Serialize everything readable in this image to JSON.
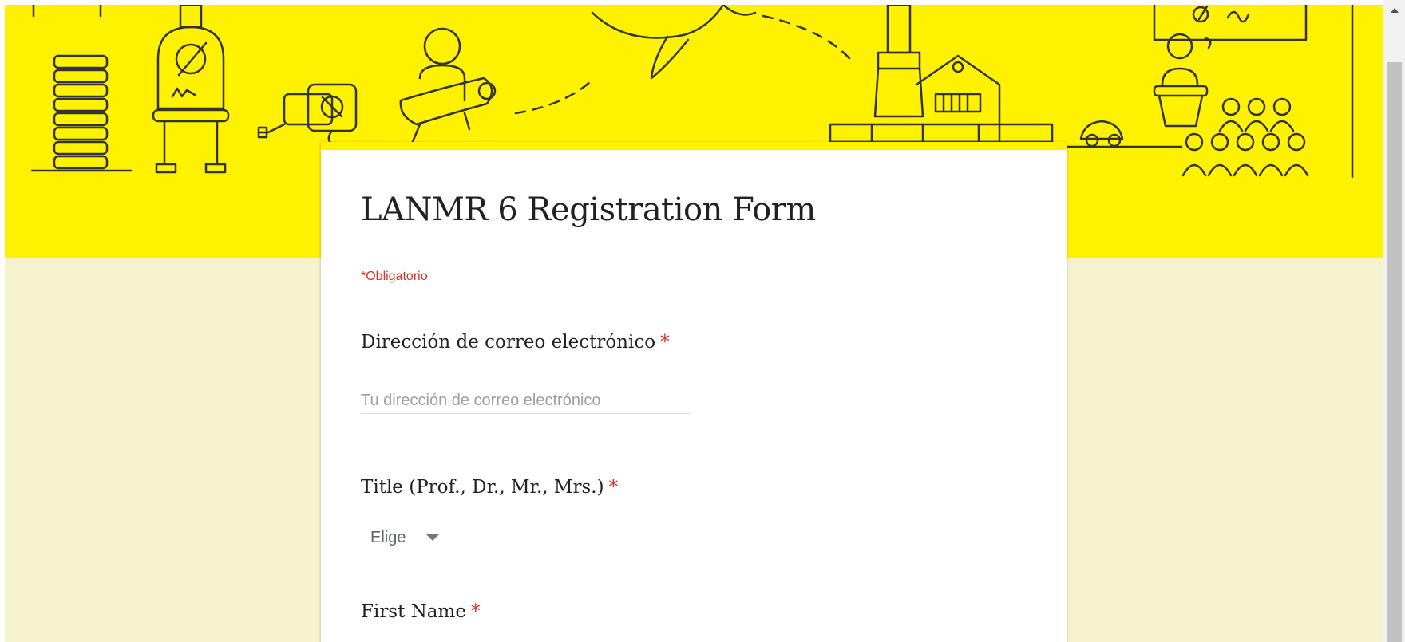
{
  "form": {
    "title": "LANMR 6 Registration Form",
    "required_note": "*Obligatorio"
  },
  "questions": [
    {
      "label": "Dirección de correo electrónico",
      "required_mark": "*"
    },
    {
      "label": "Title (Prof., Dr., Mr., Mrs.)",
      "required_mark": "*"
    },
    {
      "label": "First Name",
      "required_mark": "*"
    }
  ],
  "email_field": {
    "value": "",
    "placeholder": "Tu dirección de correo electrónico"
  },
  "title_select": {
    "selected": "Elige"
  },
  "icons": {
    "dropdown": "chevron-down-icon",
    "scroll_up": "arrow-up-icon"
  },
  "colors": {
    "banner": "#fff200",
    "page_background": "#f5f3cd",
    "card": "#ffffff",
    "required": "#d93025",
    "text": "#202124",
    "line_art": "#333333"
  }
}
